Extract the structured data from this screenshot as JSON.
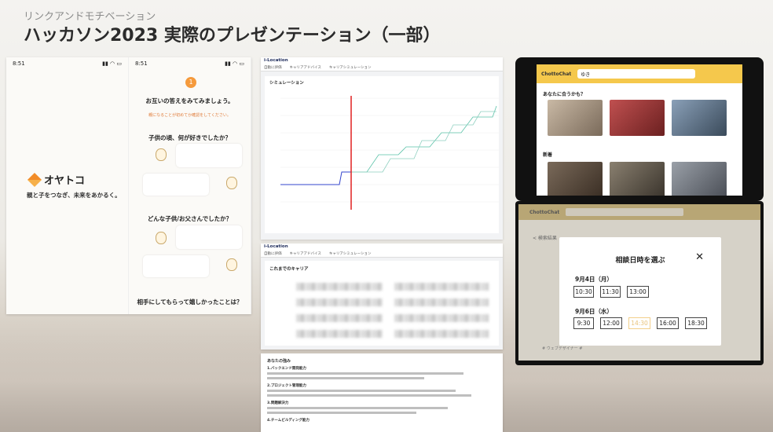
{
  "header": {
    "subtitle": "リンクアンドモチベーション",
    "title": "ハッカソン2023 実際のプレゼンテーション（一部）"
  },
  "oyatoko": {
    "time1": "8:51",
    "time2": "8:51",
    "brand": "オヤトコ",
    "tagline": "親と子をつなぎ、未来をあかるく。",
    "step": "1",
    "intro": "お互いの答えをみてみましょう。",
    "note": "親になることが初めてか確認をしてください。",
    "q1": "子供の頃、何が好きでしたか？",
    "q2": "どんな子供/お父さんでしたか？",
    "q3": "相手にしてもらって嬉しかったことは？"
  },
  "ilocation": {
    "app_name": "i-Location",
    "tabs": [
      "自動に評価",
      "キャリアアドバイス",
      "キャリアシミュレーション"
    ],
    "sim_title": "シミュレーション",
    "career_title": "これまでのキャリア",
    "docs_title": "あなたの強み",
    "docs_h1": "1.バックエンド開発能力",
    "docs_h2": "2.プロジェクト管理能力",
    "docs_h3": "3.問題解決力",
    "docs_h4": "4.チームビルディング能力"
  },
  "chottochat": {
    "logo": "ChottoChat",
    "search_value": "ゆき",
    "section1": "あなたに合うかも？",
    "section2": "新着",
    "modal_title": "相談日時を選ぶ",
    "close": "✕",
    "date1": "9月4日（月）",
    "date1_slots": [
      "10:30",
      "11:30",
      "13:00"
    ],
    "date2": "9月6日（水）",
    "date2_slots": [
      "9:30",
      "12:00",
      "14:30",
      "16:00",
      "18:30"
    ],
    "back": "< 検索結果",
    "footer": "# ウェブデザイナー #"
  }
}
